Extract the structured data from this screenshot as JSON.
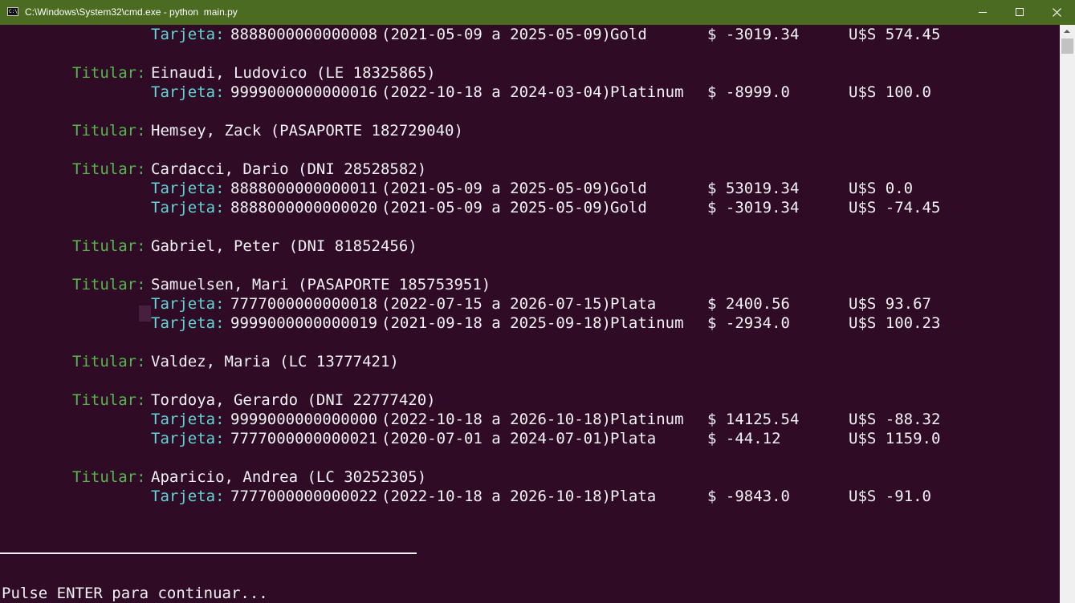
{
  "window": {
    "title": "C:\\Windows\\System32\\cmd.exe - python  main.py",
    "icon": "cmd-icon",
    "icon_text": "C:\\",
    "colors": {
      "titlebar": "#4a6b20",
      "console_bg": "#2f0b26",
      "label": "#54b94a",
      "card_label": "#61d6d6",
      "text": "#f2f2f2"
    }
  },
  "console": {
    "holders": [
      {
        "cards": [
          {
            "label": "Tarjeta:",
            "number": "8888000000000008",
            "period": "(2021-05-09 a 2025-05-09)",
            "type": "Gold",
            "balance_ars": "$ -3019.34",
            "balance_usd": "U$S 574.45"
          }
        ]
      },
      {
        "label": "Titular:",
        "name": "Einaudi, Ludovico (LE 18325865)",
        "cards": [
          {
            "label": "Tarjeta:",
            "number": "9999000000000016",
            "period": "(2022-10-18 a 2024-03-04)",
            "type": "Platinum",
            "balance_ars": "$ -8999.0",
            "balance_usd": "U$S 100.0"
          }
        ]
      },
      {
        "label": "Titular:",
        "name": "Hemsey, Zack (PASAPORTE 182729040)",
        "cards": []
      },
      {
        "label": "Titular:",
        "name": "Cardacci, Dario (DNI 28528582)",
        "cards": [
          {
            "label": "Tarjeta:",
            "number": "8888000000000011",
            "period": "(2021-05-09 a 2025-05-09)",
            "type": "Gold",
            "balance_ars": "$ 53019.34",
            "balance_usd": "U$S 0.0"
          },
          {
            "label": "Tarjeta:",
            "number": "8888000000000020",
            "period": "(2021-05-09 a 2025-05-09)",
            "type": "Gold",
            "balance_ars": "$ -3019.34",
            "balance_usd": "U$S -74.45"
          }
        ]
      },
      {
        "label": "Titular:",
        "name": "Gabriel, Peter (DNI 81852456)",
        "cards": []
      },
      {
        "label": "Titular:",
        "name": "Samuelsen, Mari (PASAPORTE 185753951)",
        "cards": [
          {
            "label": "Tarjeta:",
            "number": "7777000000000018",
            "period": "(2022-07-15 a 2026-07-15)",
            "type": "Plata",
            "balance_ars": "$ 2400.56",
            "balance_usd": "U$S 93.67"
          },
          {
            "label": "Tarjeta:",
            "number": "9999000000000019",
            "period": "(2021-09-18 a 2025-09-18)",
            "type": "Platinum",
            "balance_ars": "$ -2934.0",
            "balance_usd": "U$S 100.23"
          }
        ]
      },
      {
        "label": "Titular:",
        "name": "Valdez, Maria (LC 13777421)",
        "cards": []
      },
      {
        "label": "Titular:",
        "name": "Tordoya, Gerardo (DNI 22777420)",
        "cards": [
          {
            "label": "Tarjeta:",
            "number": "9999000000000000",
            "period": "(2022-10-18 a 2026-10-18)",
            "type": "Platinum",
            "balance_ars": "$ 14125.54",
            "balance_usd": "U$S -88.32"
          },
          {
            "label": "Tarjeta:",
            "number": "7777000000000021",
            "period": "(2020-07-01 a 2024-07-01)",
            "type": "Plata",
            "balance_ars": "$ -44.12",
            "balance_usd": "U$S 1159.0"
          }
        ]
      },
      {
        "label": "Titular:",
        "name": "Aparicio, Andrea (LC 30252305)",
        "cards": [
          {
            "label": "Tarjeta:",
            "number": "7777000000000022",
            "period": "(2022-10-18 a 2026-10-18)",
            "type": "Plata",
            "balance_ars": "$ -9843.0",
            "balance_usd": "U$S -91.0"
          }
        ]
      }
    ],
    "prompt": "Pulse ENTER para continuar..."
  }
}
